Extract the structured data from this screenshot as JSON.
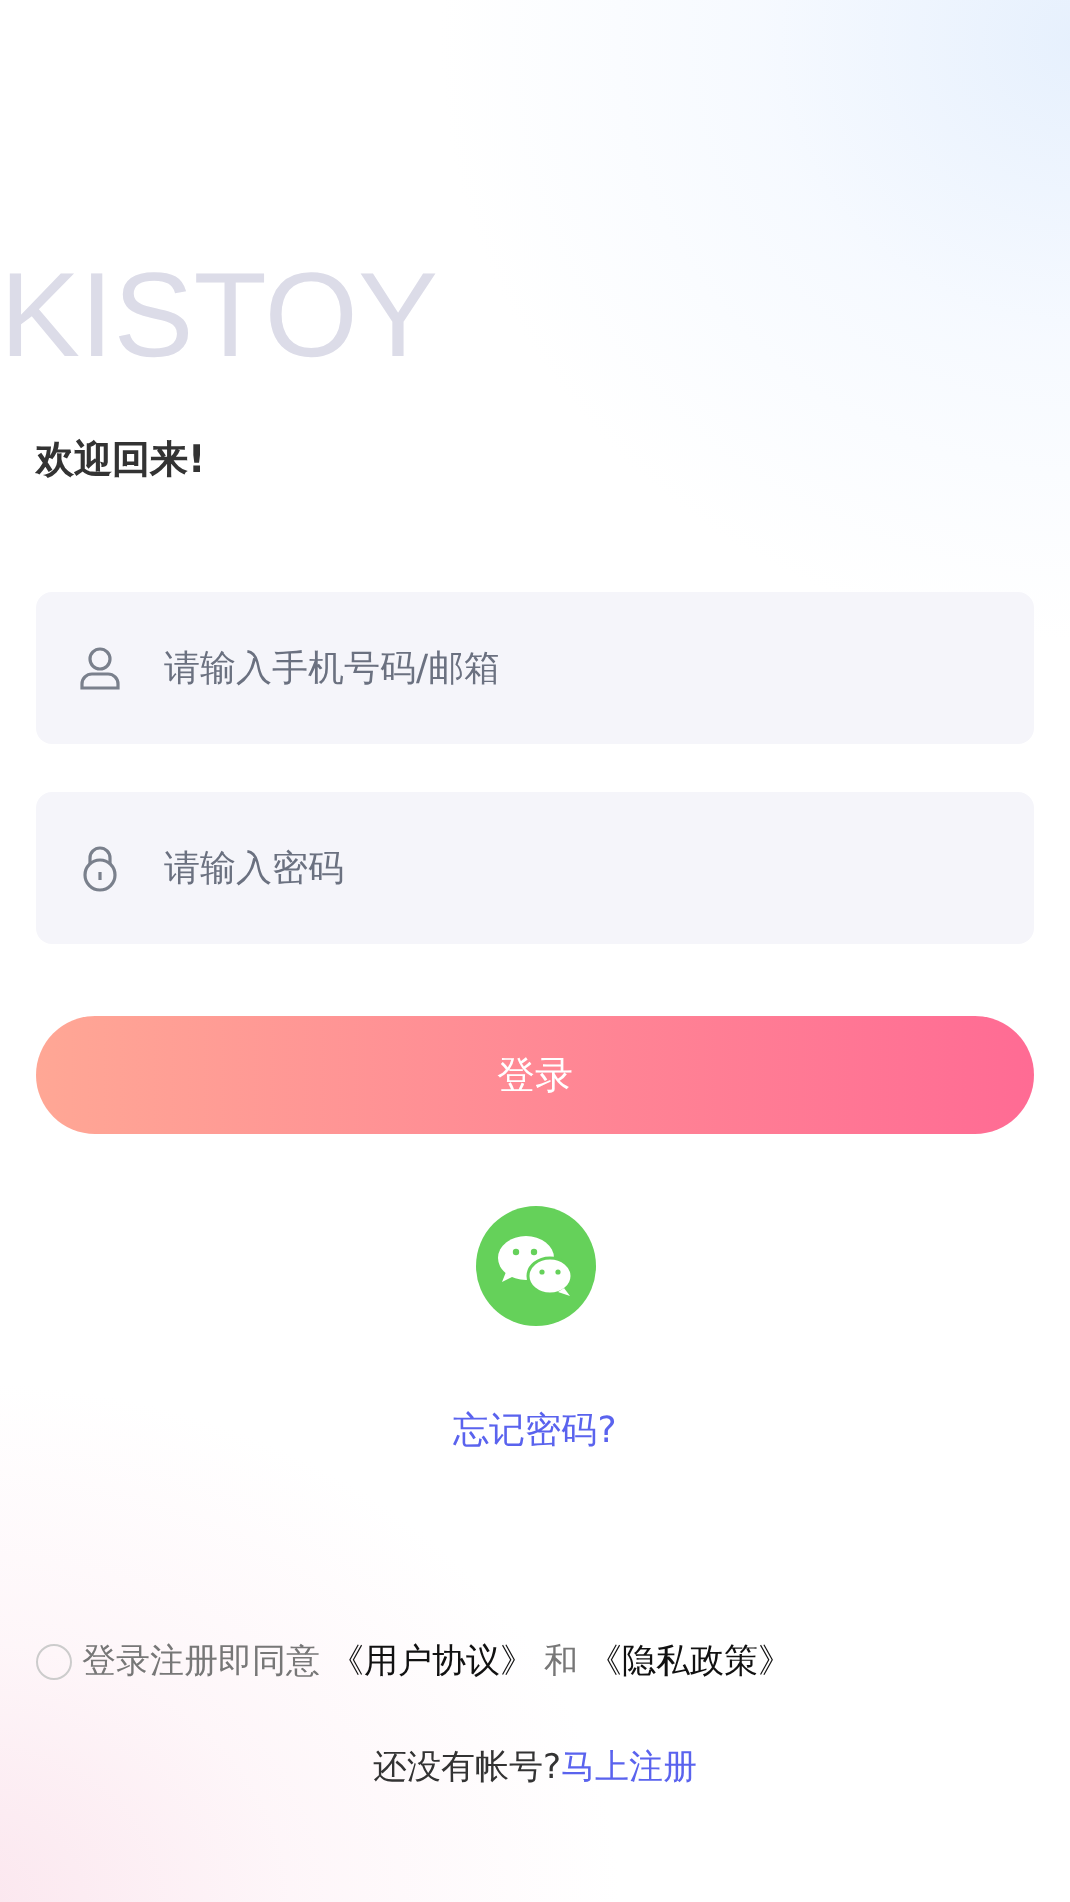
{
  "brand": "KISTOY",
  "welcome": "欢迎回来!",
  "fields": [
    {
      "kind": "user",
      "placeholder": "请输入手机号码/邮箱"
    },
    {
      "kind": "lock",
      "placeholder": "请输入密码"
    }
  ],
  "login_button": "登录",
  "forgot_link": "忘记密码?",
  "agreement": {
    "checked": false,
    "text": "登录注册即同意",
    "links": [
      "《用户协议》",
      "《隐私政策》"
    ],
    "joiner": "和"
  },
  "register": {
    "text": "还没有帐号?",
    "link": "马上注册"
  }
}
